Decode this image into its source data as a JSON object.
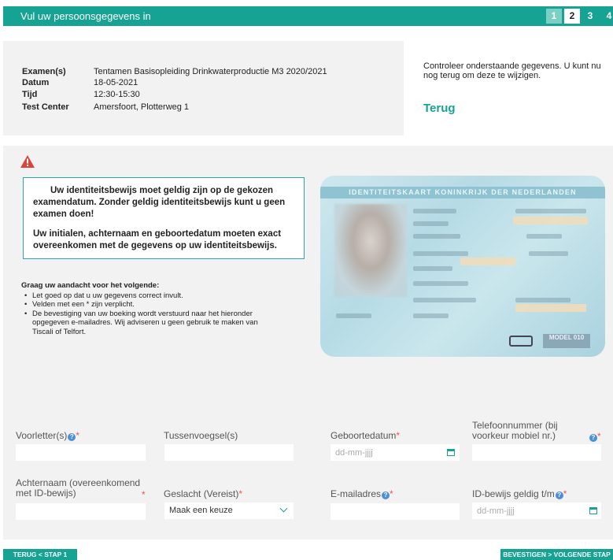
{
  "header": {
    "title": "Vul uw persoonsgegevens in",
    "steps": [
      "1",
      "2",
      "3",
      "4"
    ]
  },
  "summary": {
    "rows": [
      {
        "label": "Examen(s)",
        "value": "Tentamen Basisopleiding Drinkwaterproductie M3 2020/2021"
      },
      {
        "label": "Datum",
        "value": "18-05-2021"
      },
      {
        "label": "Tijd",
        "value": "12:30-15:30"
      },
      {
        "label": "Test Center",
        "value": "Amersfoort, Plotterweg 1"
      }
    ],
    "check_text": "Controleer onderstaande gegevens. U kunt nu nog terug om deze te wijzigen.",
    "back_link": "Terug"
  },
  "warning": {
    "paragraph1": "Uw identiteitsbewijs moet geldig zijn op de gekozen examendatum. Zonder geldig identiteitsbewijs kunt u geen examen doen!",
    "paragraph2": "Uw initialen, achternaam en geboortedatum moeten exact overeenkomen met de gegevens op uw identiteitsbewijs."
  },
  "attention": {
    "title": "Graag uw aandacht voor het volgende:",
    "items": [
      "Let goed op dat u uw gegevens correct invult.",
      "Velden met een * zijn verplicht.",
      "De bevestiging van uw boeking wordt verstuurd naar het hieronder opgegeven e-mailadres. Wij adviseren u geen gebruik te maken van Tiscali of Telfort."
    ]
  },
  "idcard": {
    "header": "IDENTITEITSKAART KONINKRIJK DER NEDERLANDEN",
    "model": "MODEL 010"
  },
  "form": {
    "voorletters": {
      "label": "Voorletter(s)",
      "value": ""
    },
    "tussenvoegsel": {
      "label": "Tussenvoegsel(s)",
      "value": ""
    },
    "geboortedatum": {
      "label": "Geboortedatum",
      "placeholder": "dd-mm-jjjj"
    },
    "telefoon": {
      "label": "Telefoonnummer (bij voorkeur mobiel nr.)",
      "value": ""
    },
    "achternaam": {
      "label": "Achternaam (overeenkomend met ID-bewijs)",
      "value": ""
    },
    "geslacht": {
      "label": "Geslacht (Vereist)",
      "selected": "Maak een keuze"
    },
    "email": {
      "label": "E-mailadres",
      "value": ""
    },
    "id_geldig": {
      "label": "ID-bewijs geldig t/m",
      "placeholder": "dd-mm-jjjj"
    },
    "required_mark": "*",
    "help_mark": "?"
  },
  "buttons": {
    "back": "TERUG < STAP 1",
    "next": "BEVESTIGEN > VOLGENDE STAP"
  },
  "colors": {
    "accent": "#16a394",
    "required": "#e55555",
    "warning": "#d9453a"
  }
}
